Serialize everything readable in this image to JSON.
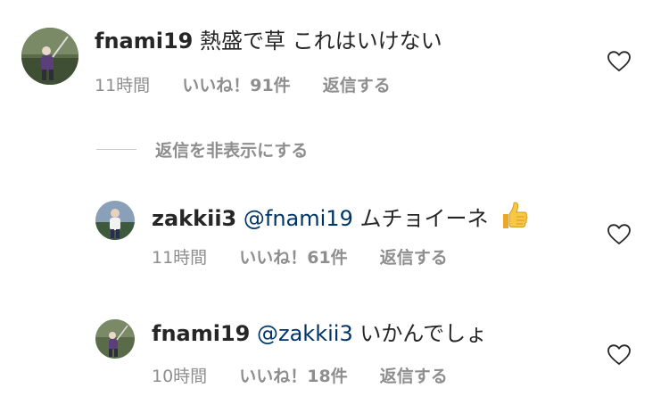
{
  "comments": [
    {
      "username": "fnami19",
      "text": "熱盛で草  これはいけない",
      "time": "11時間",
      "likes": "いいね！91件",
      "reply": "返信する",
      "avatar_icon": "golfer-avatar-icon",
      "like_icon": "heart-outline-icon"
    }
  ],
  "hide_replies_label": "返信を非表示にする",
  "replies": [
    {
      "username": "zakkii3",
      "mention": "@fnami19",
      "text": "ムチョイーネ",
      "emoji": "thumbs-up-icon",
      "time": "11時間",
      "likes": "いいね！61件",
      "reply": "返信する",
      "avatar_icon": "player-avatar-icon",
      "like_icon": "heart-outline-icon"
    },
    {
      "username": "fnami19",
      "mention": "@zakkii3",
      "text": "いかんでしょ",
      "time": "10時間",
      "likes": "いいね！18件",
      "reply": "返信する",
      "avatar_icon": "golfer-avatar-icon",
      "like_icon": "heart-outline-icon"
    }
  ],
  "colors": {
    "text": "#262626",
    "secondary": "#8e8e8e",
    "mention": "#003569",
    "divider": "#c7c7c7"
  }
}
